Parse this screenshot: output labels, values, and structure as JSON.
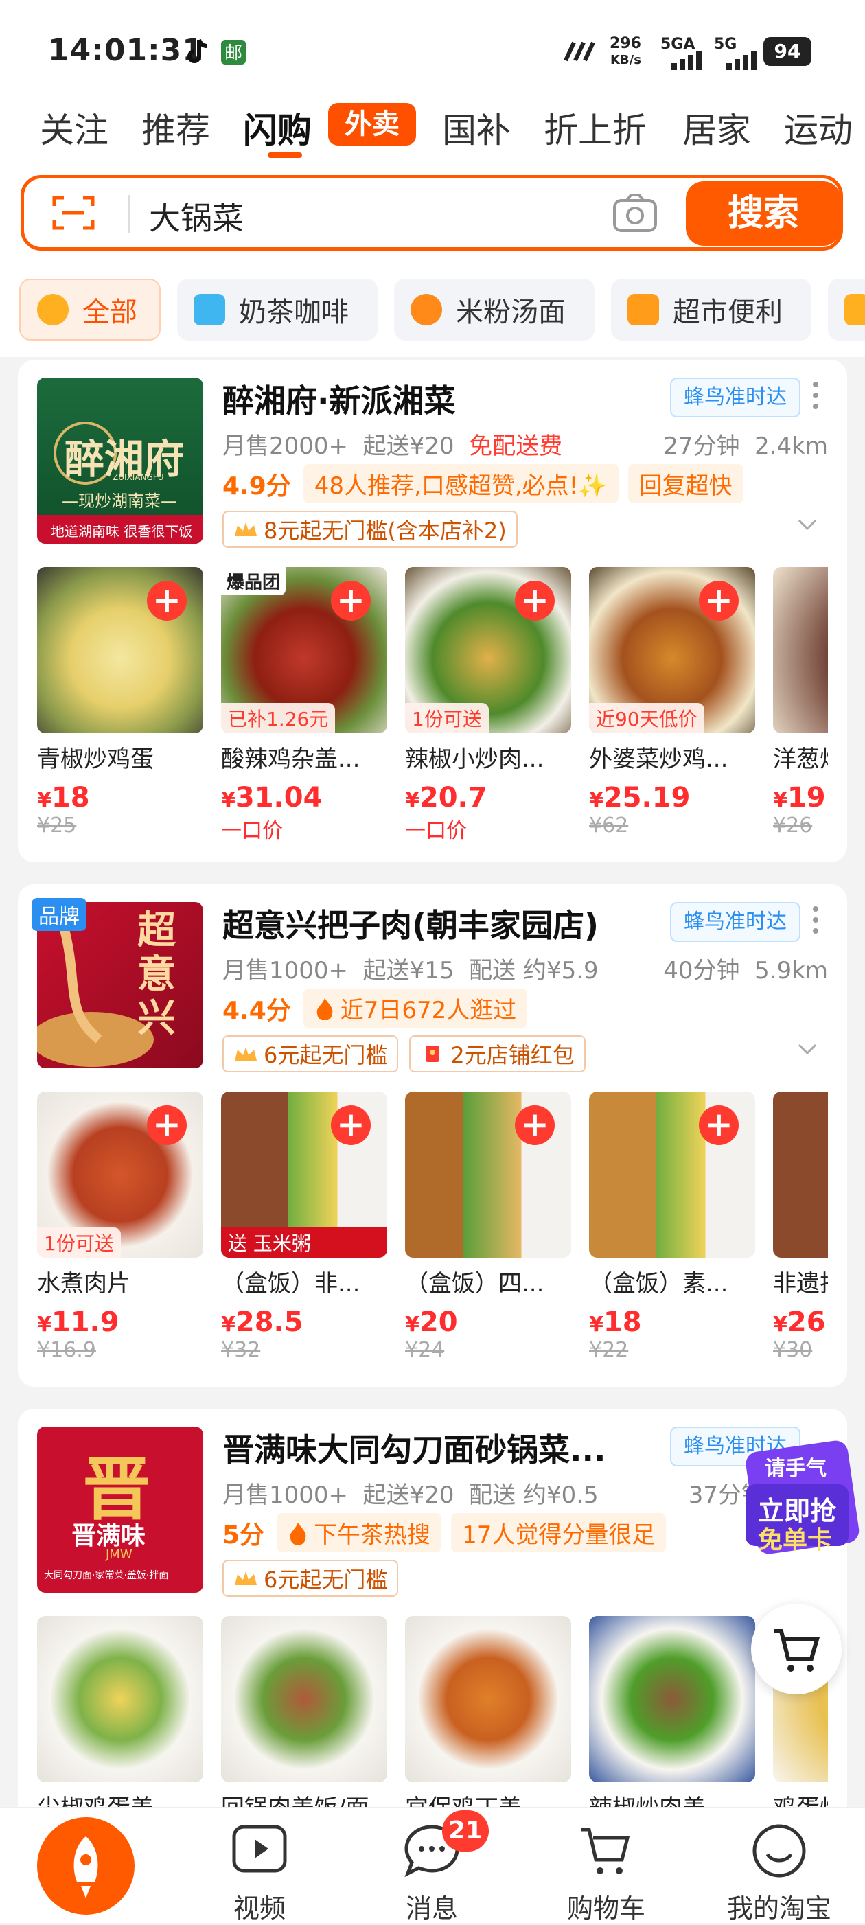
{
  "status_bar": {
    "time": "14:01:31",
    "net_speed_value": "296",
    "net_speed_unit": "KB/s",
    "sim1": "5GA",
    "sim2": "5G",
    "battery": "94"
  },
  "tabs": [
    {
      "label": "关注"
    },
    {
      "label": "推荐"
    },
    {
      "label": "闪购"
    },
    {
      "label": "外卖"
    },
    {
      "label": "国补"
    },
    {
      "label": "折上折"
    },
    {
      "label": "居家"
    },
    {
      "label": "运动"
    }
  ],
  "search": {
    "query": "大锅菜",
    "button": "搜索"
  },
  "categories": [
    {
      "label": "全部"
    },
    {
      "label": "奶茶咖啡"
    },
    {
      "label": "米粉汤面"
    },
    {
      "label": "超市便利"
    }
  ],
  "stores": [
    {
      "name": "醉湘府·新派湘菜",
      "delivery_badge": "蜂鸟准时达",
      "logo_text": "醉湘府",
      "logo_sub": "ZUIXIANGFU",
      "logo_tag": "—现炒湖南菜—",
      "logo_footer": "地道湖南味 很香很下饭",
      "monthly_sales": "月售2000+",
      "min_order": "起送¥20",
      "delivery_fee": "免配送费",
      "time": "27分钟",
      "distance": "2.4km",
      "score": "4.9分",
      "chips": [
        "48人推荐,口感超赞,必点!✨",
        "回复超快"
      ],
      "coupons": [
        "8元起无门槛(含本店补2)"
      ],
      "dishes": [
        {
          "name": "青椒炒鸡蛋",
          "price": "18",
          "old_price": "¥25",
          "tag": ""
        },
        {
          "name": "酸辣鸡杂盖...",
          "price": "31.04",
          "sub": "一口价",
          "tag": "已补1.26元",
          "top_tag": "爆品团"
        },
        {
          "name": "辣椒小炒肉...",
          "price": "20.7",
          "sub": "一口价",
          "tag": "1份可送"
        },
        {
          "name": "外婆菜炒鸡...",
          "price": "25.19",
          "old_price": "¥62",
          "tag": "近90天低价"
        },
        {
          "name": "洋葱炒",
          "price": "19",
          "old_price": "¥26",
          "tag": ""
        }
      ]
    },
    {
      "name": "超意兴把子肉(朝丰家园店)",
      "delivery_badge": "蜂鸟准时达",
      "logo_text": "超意兴",
      "brand_tag": "品牌",
      "monthly_sales": "月售1000+",
      "min_order": "起送¥15",
      "delivery_fee": "配送 约¥5.9",
      "time": "40分钟",
      "distance": "5.9km",
      "score": "4.4分",
      "chips": [
        "近7日672人逛过"
      ],
      "coupons": [
        "6元起无门槛",
        "2元店铺红包"
      ],
      "dishes": [
        {
          "name": "水煮肉片",
          "price": "11.9",
          "old_price": "¥16.9",
          "tag": "1份可送"
        },
        {
          "name": "（盒饭）非...",
          "price": "28.5",
          "old_price": "¥32",
          "tag": "送 玉米粥"
        },
        {
          "name": "（盒饭）四...",
          "price": "20",
          "old_price": "¥24",
          "tag": ""
        },
        {
          "name": "（盒饭）素...",
          "price": "18",
          "old_price": "¥22",
          "tag": ""
        },
        {
          "name": "非遗把",
          "price": "26",
          "old_price": "¥30",
          "tag": ""
        }
      ]
    },
    {
      "name": "晋满味大同勾刀面砂锅菜...",
      "delivery_badge": "蜂鸟准时达",
      "logo_text": "晋满味",
      "logo_big": "晋",
      "logo_sub": "JMW",
      "logo_footer": "大同勾刀面·家常菜·盖饭·拌面",
      "monthly_sales": "月售1000+",
      "min_order": "起送¥20",
      "delivery_fee": "配送 约¥0.5",
      "time": "37分钟",
      "score": "5分",
      "chips": [
        "下午茶热搜",
        "17人觉得分量很足"
      ],
      "coupons": [
        "6元起无门槛"
      ],
      "dishes": [
        {
          "name": "尖椒鸡蛋盖"
        },
        {
          "name": "回锅肉盖饭/面"
        },
        {
          "name": "宫保鸡丁盖"
        },
        {
          "name": "辣椒炒肉盖"
        },
        {
          "name": "鸡蛋炒"
        }
      ]
    }
  ],
  "promo": {
    "line1": "请手气",
    "line2": "立即抢",
    "line3": "免单卡"
  },
  "bottom_nav": [
    {
      "label": ""
    },
    {
      "label": "视频"
    },
    {
      "label": "消息"
    },
    {
      "label": "购物车"
    },
    {
      "label": "我的淘宝"
    }
  ],
  "messages_badge": "21",
  "colors": {
    "accent": "#ff5000",
    "price": "#ff2d2d",
    "fengniao": "#2a8ff0"
  }
}
